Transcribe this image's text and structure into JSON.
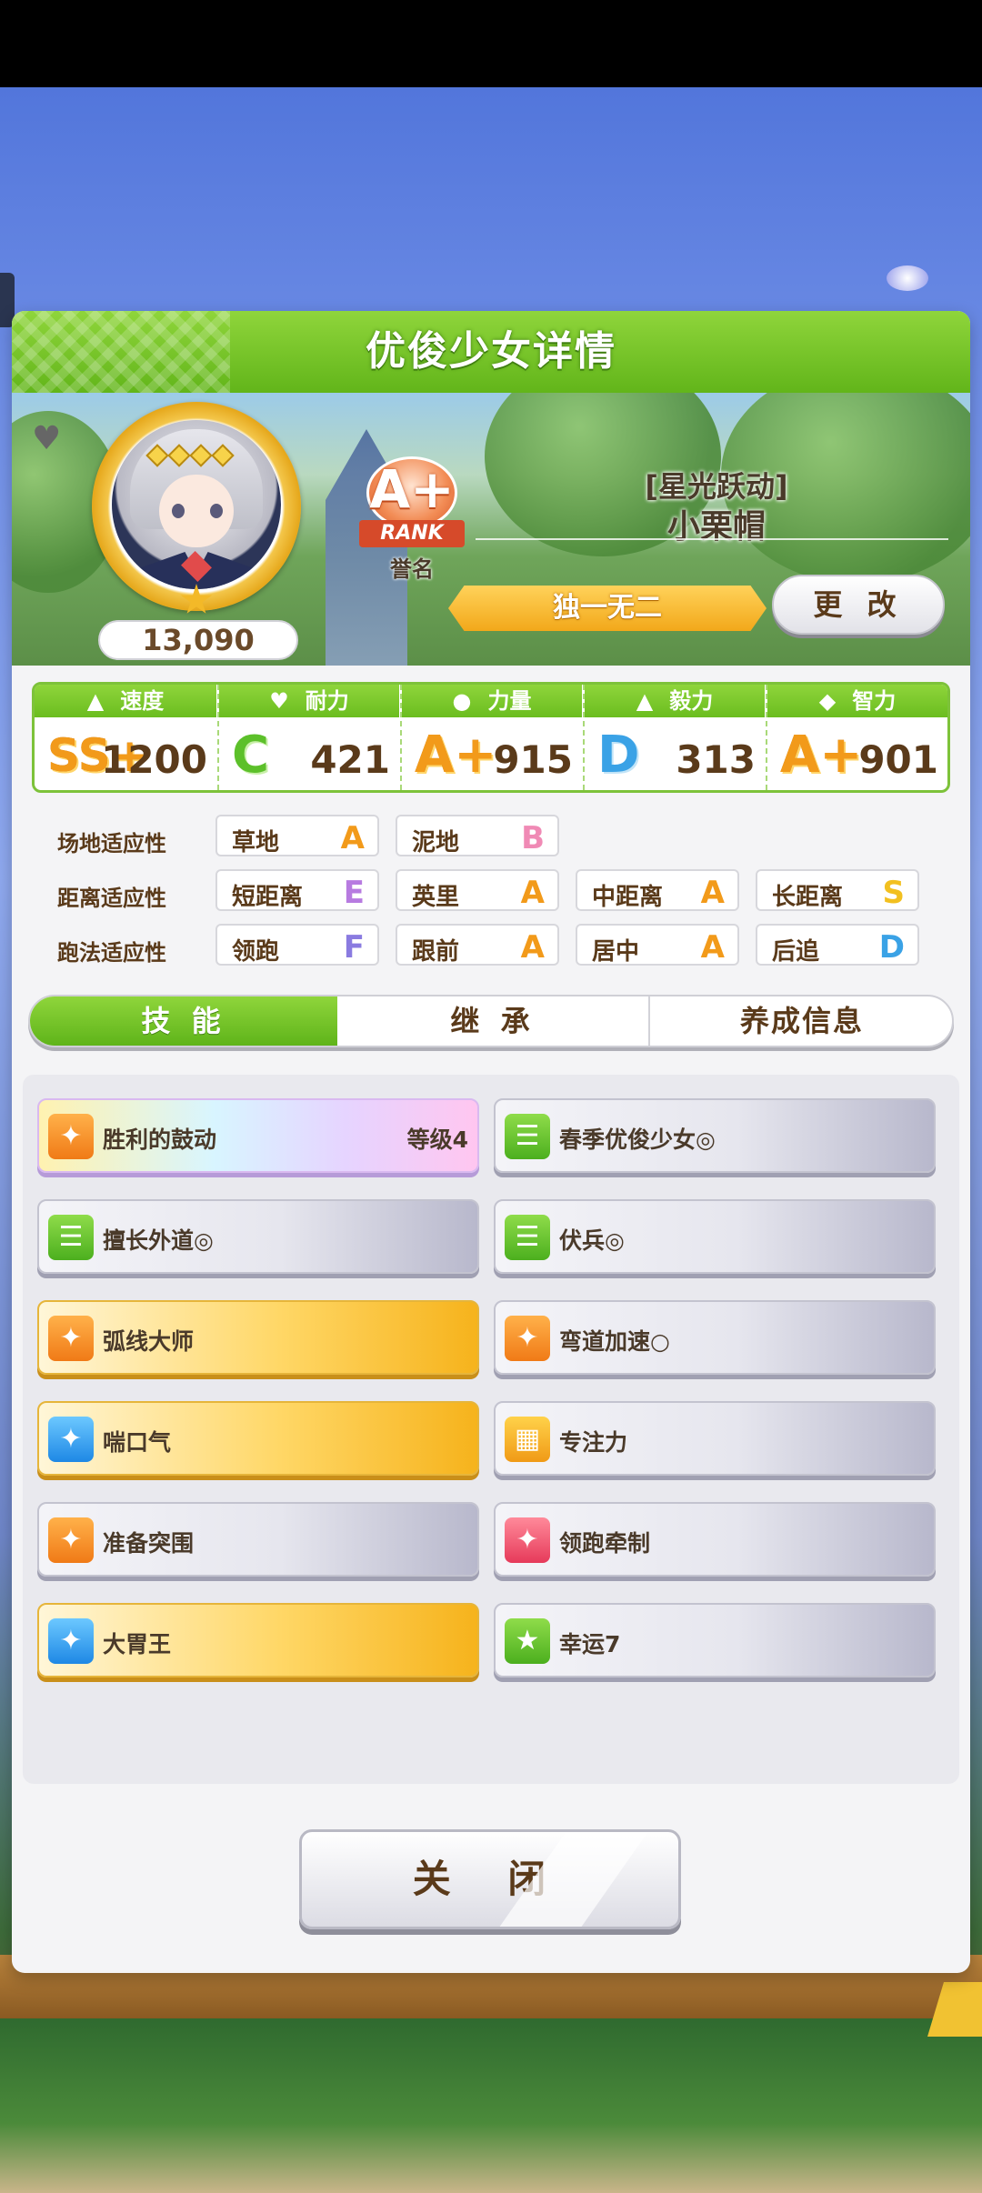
{
  "dialog": {
    "title": "优俊少女详情"
  },
  "character": {
    "costume": "[星光跃动]",
    "name": "小栗帽",
    "fans": "13,090",
    "rank": "A+",
    "rank_label": "RANK",
    "honor_label": "誉名",
    "title": "独一无二",
    "change_label": "更 改"
  },
  "stats": [
    {
      "label": "速度",
      "grade": "SS+",
      "value": "1200",
      "icon": "shoe-icon"
    },
    {
      "label": "耐力",
      "grade": "C",
      "value": "421",
      "icon": "heart-icon"
    },
    {
      "label": "力量",
      "grade": "A+",
      "value": "915",
      "icon": "muscle-icon"
    },
    {
      "label": "毅力",
      "grade": "D",
      "value": "313",
      "icon": "flame-icon"
    },
    {
      "label": "智力",
      "grade": "A+",
      "value": "901",
      "icon": "graduation-cap-icon"
    }
  ],
  "aptitude": {
    "track": {
      "label": "场地适应性",
      "items": [
        {
          "name": "草地",
          "grade": "A"
        },
        {
          "name": "泥地",
          "grade": "B"
        }
      ]
    },
    "distance": {
      "label": "距离适应性",
      "items": [
        {
          "name": "短距离",
          "grade": "E"
        },
        {
          "name": "英里",
          "grade": "A"
        },
        {
          "name": "中距离",
          "grade": "A"
        },
        {
          "name": "长距离",
          "grade": "S"
        }
      ]
    },
    "strategy": {
      "label": "跑法适应性",
      "items": [
        {
          "name": "领跑",
          "grade": "F"
        },
        {
          "name": "跟前",
          "grade": "A"
        },
        {
          "name": "居中",
          "grade": "A"
        },
        {
          "name": "后追",
          "grade": "D"
        }
      ]
    }
  },
  "tabs": [
    "技 能",
    "继 承",
    "养成信息"
  ],
  "skills": [
    {
      "name": "胜利的鼓动",
      "level": "等级4",
      "style": "rainbow",
      "icon": "running-horse-icon"
    },
    {
      "name": "春季优俊少女◎",
      "style": "silver",
      "icon": "card-icon"
    },
    {
      "name": "擅长外道◎",
      "style": "silver",
      "icon": "card-icon"
    },
    {
      "name": "伏兵◎",
      "style": "silver",
      "icon": "card-icon"
    },
    {
      "name": "弧线大师",
      "style": "gold",
      "icon": "running-horse-icon"
    },
    {
      "name": "弯道加速○",
      "style": "silver",
      "icon": "running-horse-icon"
    },
    {
      "name": "喘口气",
      "style": "gold",
      "icon": "sparkle-icon"
    },
    {
      "name": "专注力",
      "style": "silver",
      "icon": "gate-icon"
    },
    {
      "name": "准备突围",
      "style": "silver",
      "icon": "running-horse-icon"
    },
    {
      "name": "领跑牵制",
      "style": "silver",
      "icon": "sparkle-icon"
    },
    {
      "name": "大胃王",
      "style": "gold",
      "icon": "sparkle-icon"
    },
    {
      "name": "幸运7",
      "style": "silver",
      "icon": "lucky-horse-icon"
    }
  ],
  "close_label": "关 闭"
}
